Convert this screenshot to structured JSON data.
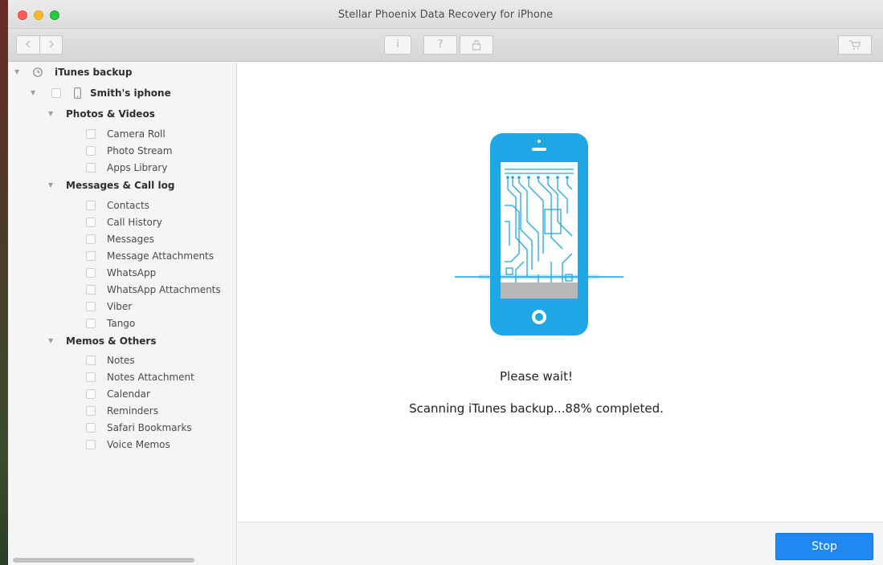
{
  "window": {
    "title": "Stellar Phoenix Data Recovery for iPhone"
  },
  "toolbar": {
    "back_icon": "chevron-left-icon",
    "forward_icon": "chevron-right-icon",
    "info_label": "i",
    "help_label": "?",
    "lock_icon": "lock-icon",
    "cart_icon": "cart-icon"
  },
  "tree": {
    "root": {
      "label": "iTunes backup",
      "icon": "backup-icon"
    },
    "device": {
      "label": "Smith's iphone",
      "icon": "iphone-icon"
    },
    "groups": [
      {
        "label": "Photos & Videos",
        "items": [
          "Camera Roll",
          "Photo Stream",
          "Apps Library"
        ]
      },
      {
        "label": "Messages & Call log",
        "items": [
          "Contacts",
          "Call History",
          "Messages",
          "Message Attachments",
          "WhatsApp",
          "WhatsApp Attachments",
          "Viber",
          "Tango"
        ]
      },
      {
        "label": "Memos & Others",
        "items": [
          "Notes",
          "Notes Attachment",
          "Calendar",
          "Reminders",
          "Safari Bookmarks",
          "Voice Memos"
        ]
      }
    ]
  },
  "main": {
    "illustration": "phone-scan-icon",
    "wait_text": "Please wait!",
    "status_text": "Scanning iTunes backup...88% completed.",
    "progress_percent": 88
  },
  "footer": {
    "stop_label": "Stop"
  },
  "colors": {
    "accent": "#1f88f2",
    "phone": "#1ea7e4"
  }
}
